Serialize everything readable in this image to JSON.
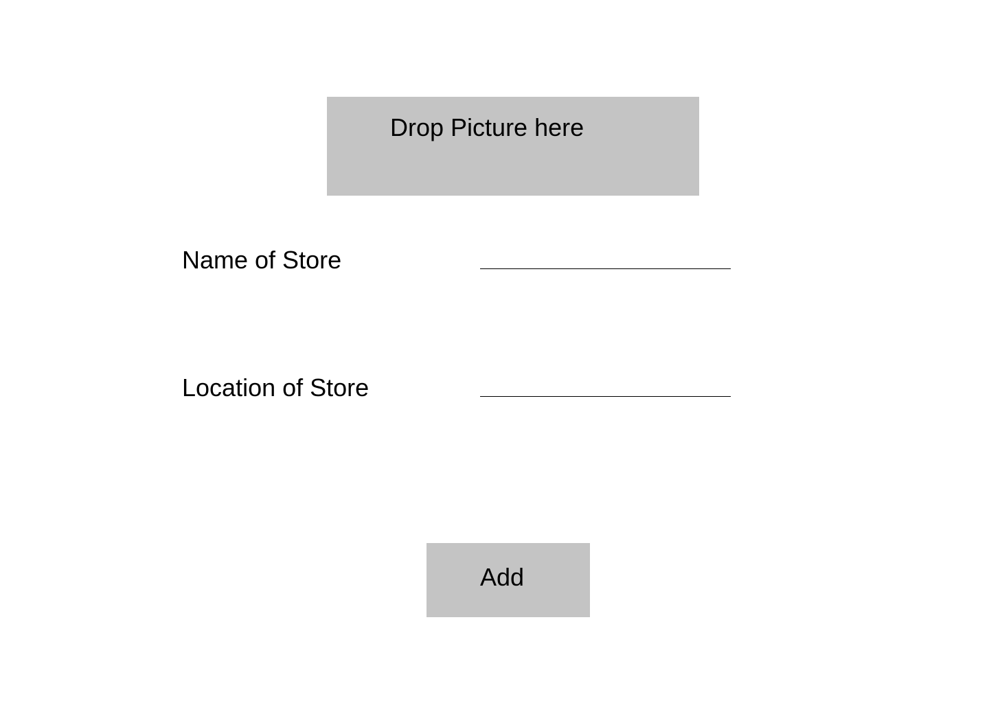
{
  "dropzone": {
    "label": "Drop Picture here"
  },
  "form": {
    "name_label": "Name of Store",
    "name_value": "",
    "location_label": "Location of Store",
    "location_value": ""
  },
  "actions": {
    "add_label": "Add"
  },
  "colors": {
    "background": "#ffffff",
    "panel_gray": "#c4c4c4",
    "text": "#000000"
  }
}
